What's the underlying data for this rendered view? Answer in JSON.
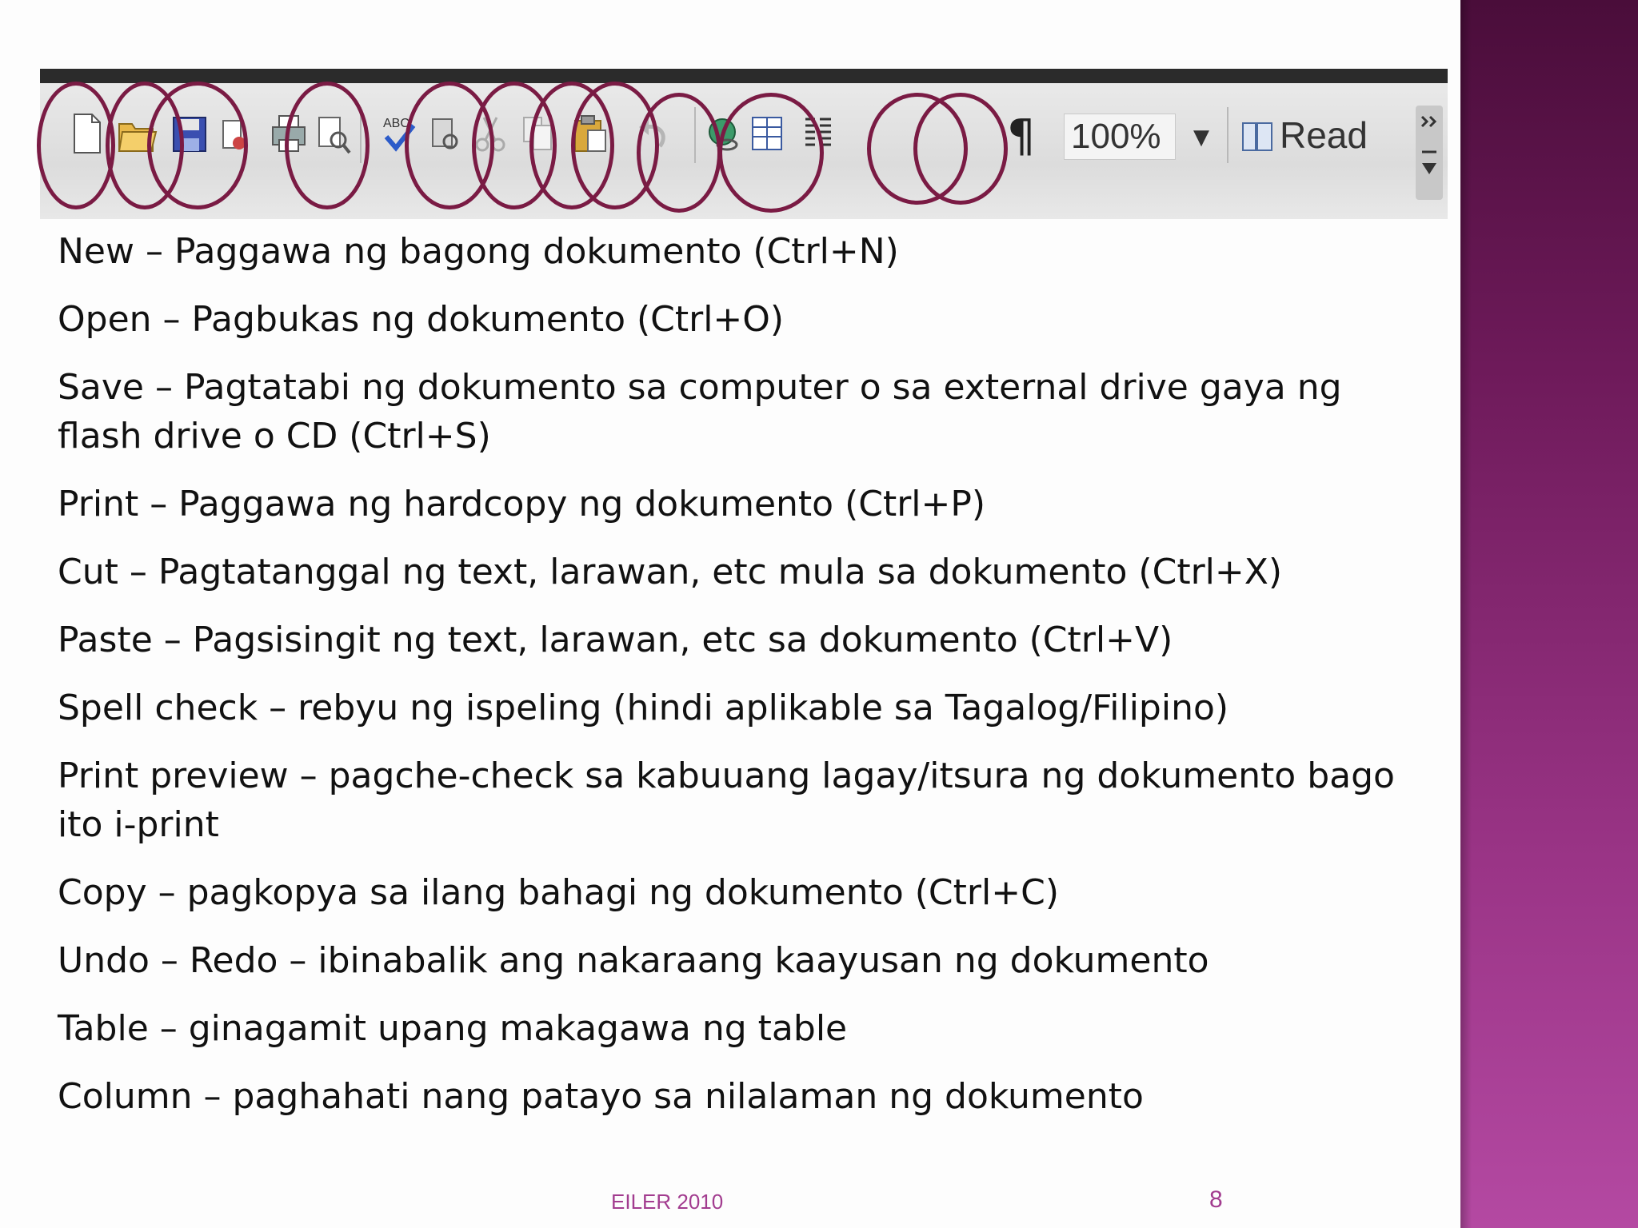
{
  "toolbar": {
    "buttons": [
      {
        "name": "new-icon"
      },
      {
        "name": "open-icon"
      },
      {
        "name": "save-icon"
      },
      {
        "name": "permission-icon"
      },
      {
        "name": "print-icon"
      },
      {
        "name": "print-preview-icon"
      },
      {
        "name": "spell-check-icon"
      },
      {
        "name": "research-icon"
      },
      {
        "name": "cut-icon"
      },
      {
        "name": "copy-icon"
      },
      {
        "name": "paste-icon"
      },
      {
        "name": "undo-icon"
      },
      {
        "name": "hyperlink-icon"
      },
      {
        "name": "table-icon"
      },
      {
        "name": "columns-icon"
      },
      {
        "name": "paragraph-icon"
      }
    ],
    "zoom_value": "100%",
    "read_label": "Read",
    "highlight_color": "#7a1b44"
  },
  "items": [
    "New – Paggawa ng bagong dokumento (Ctrl+N)",
    "Open – Pagbukas ng dokumento (Ctrl+O)",
    "Save – Pagtatabi ng dokumento sa computer o sa external drive gaya ng flash drive o CD (Ctrl+S)",
    "Print – Paggawa ng hardcopy ng dokumento (Ctrl+P)",
    "Cut – Pagtatanggal ng text, larawan, etc mula sa dokumento (Ctrl+X)",
    "Paste – Pagsisingit ng text, larawan, etc sa dokumento (Ctrl+V)",
    "Spell check – rebyu ng ispeling (hindi aplikable sa Tagalog/Filipino)",
    "Print preview – pagche-check sa kabuuang lagay/itsura ng dokumento bago ito i-print",
    "Copy – pagkopya sa ilang bahagi ng dokumento (Ctrl+C)",
    "Undo – Redo – ibinabalik ang nakaraang kaayusan ng dokumento",
    "Table – ginagamit upang makagawa ng table",
    "Column – paghahati nang patayo sa nilalaman ng dokumento"
  ],
  "footer": {
    "author": "EILER 2010",
    "page_number": "8"
  },
  "colors": {
    "accent": "#a23c8f",
    "side_band": "#7a1e66"
  }
}
